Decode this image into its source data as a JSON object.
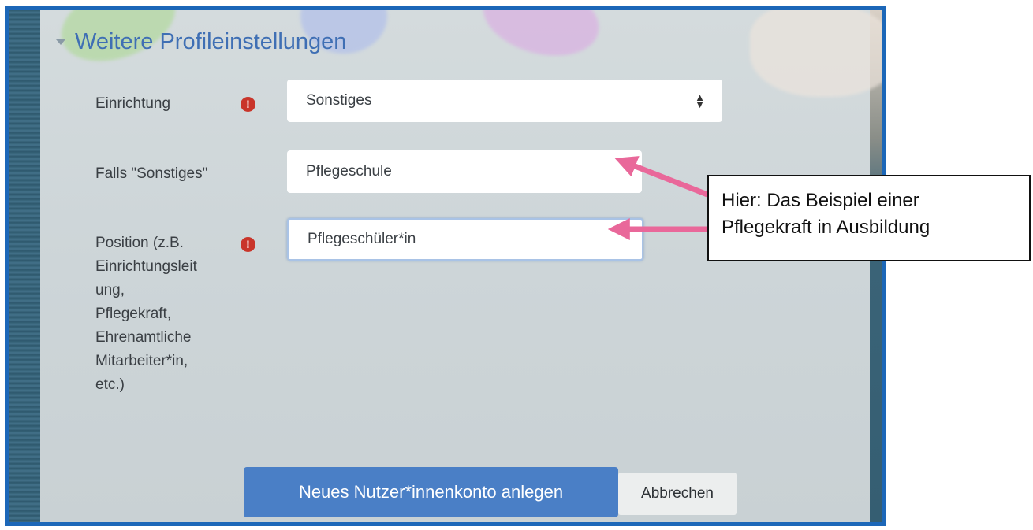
{
  "section": {
    "title": "Weitere Profileinstellungen"
  },
  "fields": {
    "einrichtung": {
      "label": "Einrichtung",
      "value": "Sonstiges",
      "required_icon": "exclamation-circle-icon"
    },
    "falls_sonstiges": {
      "label": "Falls \"Sonstiges\"",
      "value": "Pflegeschule"
    },
    "position": {
      "label_lines": [
        "Position (z.B.",
        "Einrichtungsleit",
        "ung,",
        "Pflegekraft,",
        "Ehrenamtliche",
        "Mitarbeiter*in,",
        "etc.)"
      ],
      "value": "Pflegeschüler*in",
      "required_icon": "exclamation-circle-icon"
    }
  },
  "buttons": {
    "submit": "Neues Nutzer*innenkonto anlegen",
    "cancel": "Abbrechen"
  },
  "callout": {
    "line1": "Hier: Das Beispiel einer",
    "line2": "Pflegekraft in Ausbildung"
  },
  "colors": {
    "frame_border": "#1c67b8",
    "section_title": "#3f6fb4",
    "required": "#c9352a",
    "primary_button": "#4a7fc6",
    "arrow": "#e9689a"
  }
}
